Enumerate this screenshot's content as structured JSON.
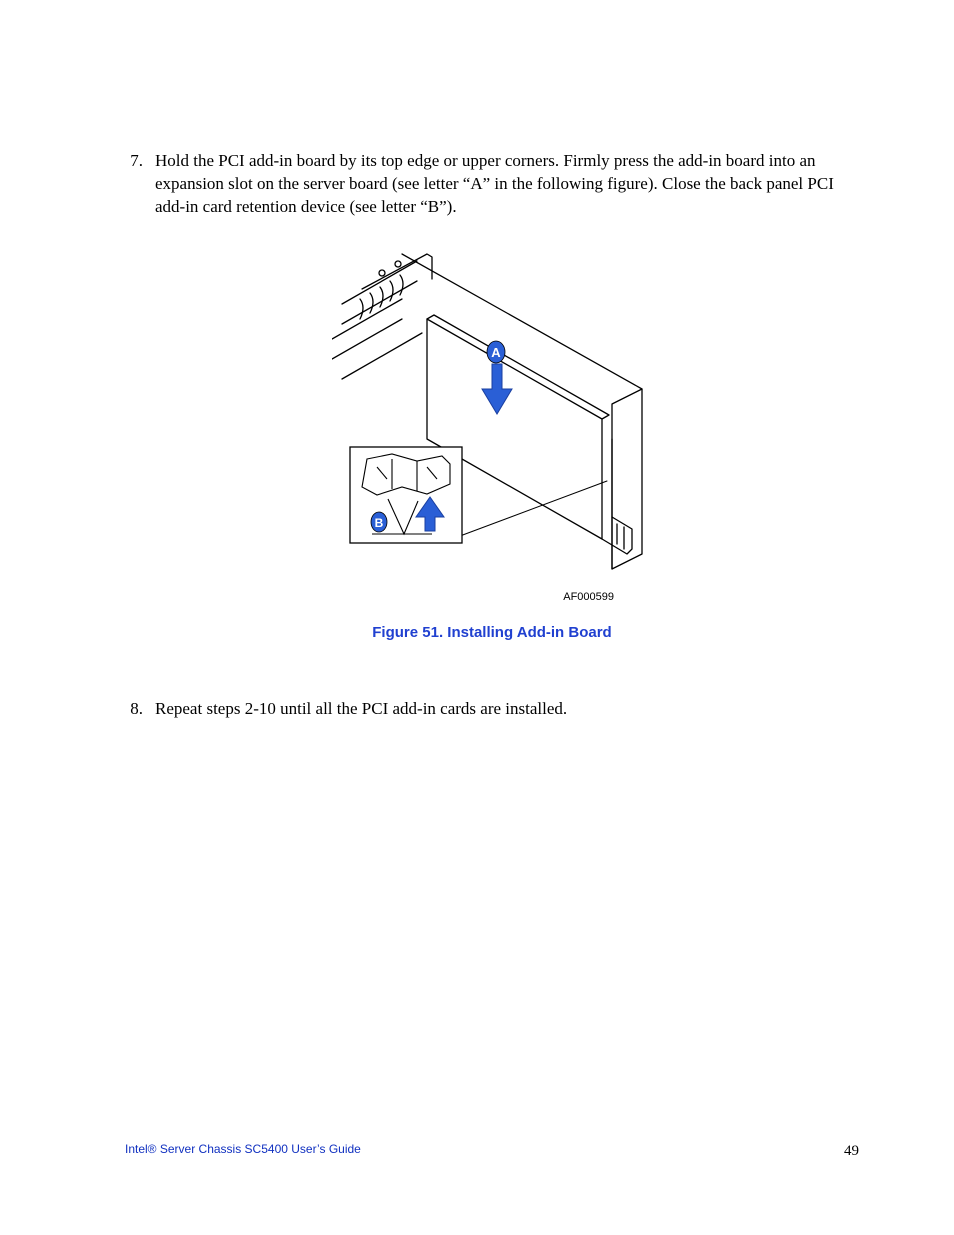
{
  "steps": [
    {
      "num": "7.",
      "text": "Hold the PCI add-in board by its top edge or upper corners. Firmly press the add-in board into an expansion slot on the server board (see letter “A” in the following figure). Close the back panel PCI add-in card retention device (see letter “B”)."
    },
    {
      "num": "8.",
      "text": "Repeat steps 2-10 until all the PCI add-in cards are installed."
    }
  ],
  "figure": {
    "ref": "AF000599",
    "caption": "Figure 51. Installing Add-in Board",
    "callouts": {
      "a": "A",
      "b": "B"
    }
  },
  "footer": {
    "title": "Intel® Server Chassis SC5400 User’s Guide",
    "page": "49"
  }
}
